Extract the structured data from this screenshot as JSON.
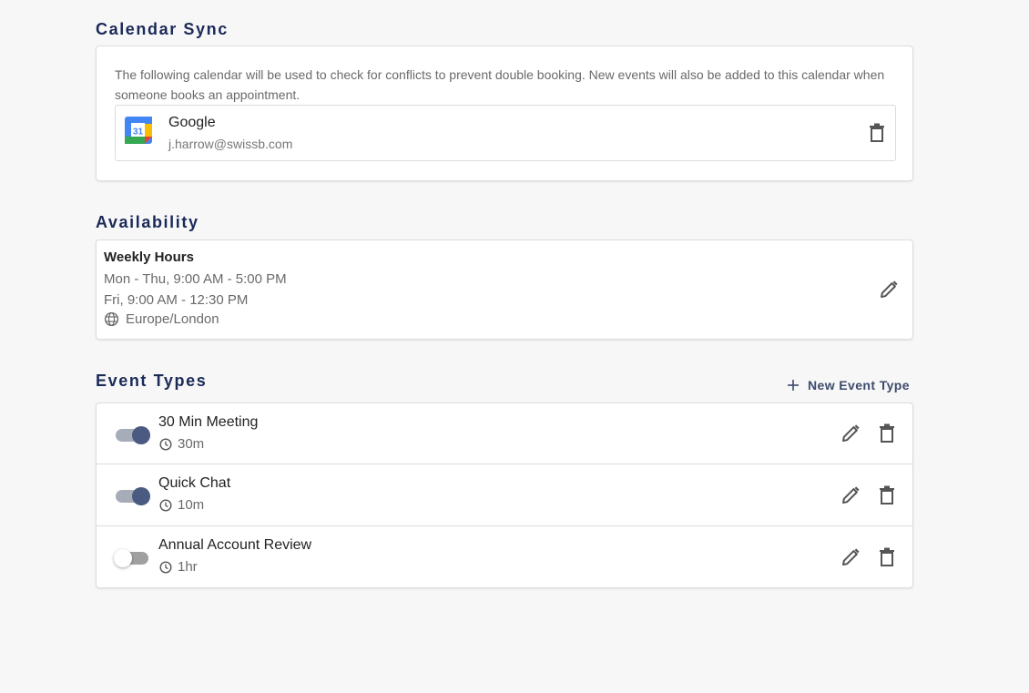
{
  "calendar_sync": {
    "title": "Calendar Sync",
    "description": "The following calendar will be used to check for conflicts to prevent double booking. New events will also be added to this calendar when someone books an appointment.",
    "calendar": {
      "provider": "Google",
      "email": "j.harrow@swissb.com",
      "icon": "google-calendar-icon",
      "icon_day": "31"
    }
  },
  "availability": {
    "title": "Availability",
    "heading": "Weekly Hours",
    "lines": [
      "Mon - Thu, 9:00 AM - 5:00 PM",
      "Fri, 9:00 AM - 12:30 PM"
    ],
    "timezone": "Europe/London"
  },
  "event_types": {
    "title": "Event Types",
    "new_button_label": "New Event Type",
    "items": [
      {
        "name": "30 Min Meeting",
        "duration": "30m",
        "enabled": true
      },
      {
        "name": "Quick Chat",
        "duration": "10m",
        "enabled": true
      },
      {
        "name": "Annual Account Review",
        "duration": "1hr",
        "enabled": false
      }
    ]
  },
  "colors": {
    "section_title": "#1b2a57",
    "toggle_on_knob": "#4a5a80",
    "toggle_on_track": "#a7acb9",
    "toggle_off_track": "#a0a0a0"
  }
}
